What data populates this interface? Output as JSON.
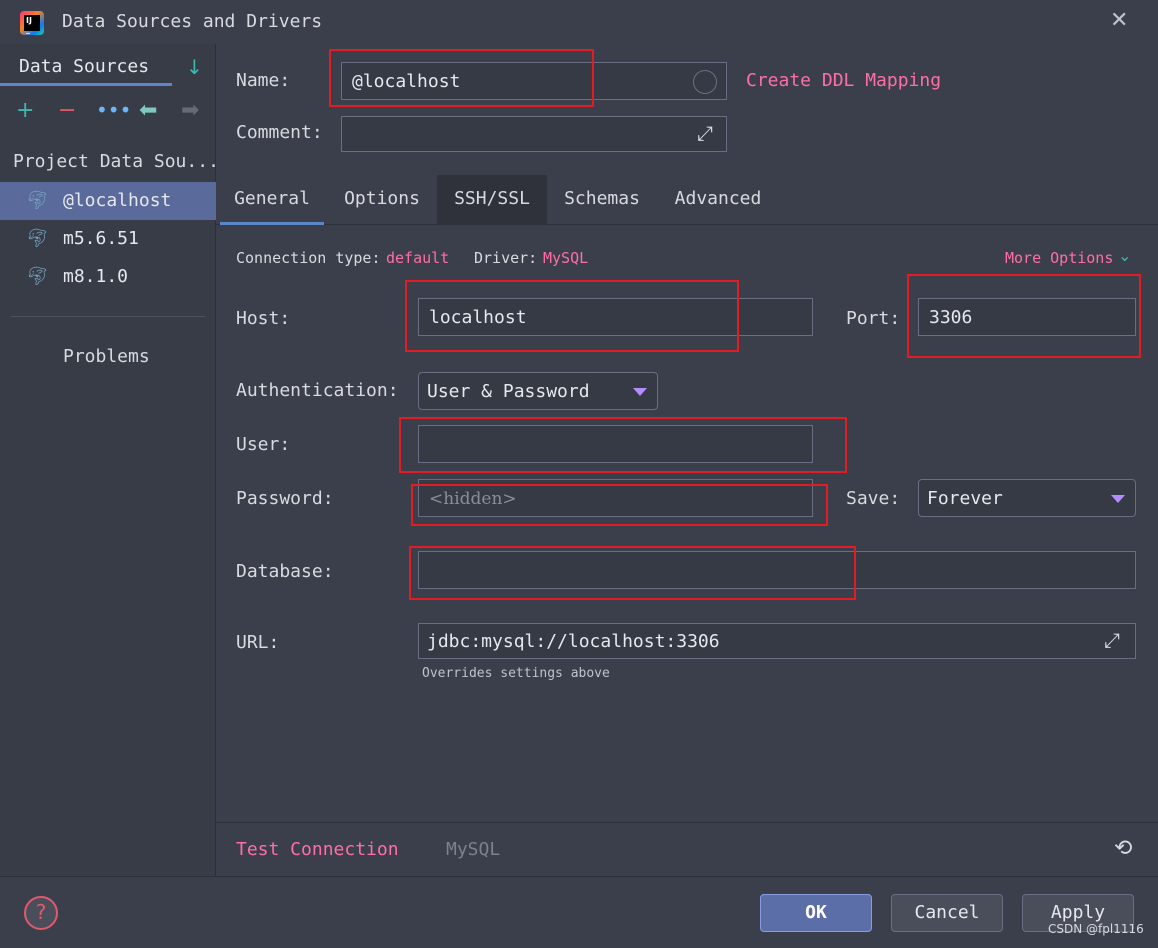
{
  "window": {
    "title": "Data Sources and Drivers",
    "close": "✕"
  },
  "sidebar": {
    "tab_label": "Data Sources",
    "section_title": "Project Data Sou...",
    "items": [
      {
        "label": "@localhost",
        "selected": true
      },
      {
        "label": "m5.6.51",
        "selected": false
      },
      {
        "label": "m8.1.0",
        "selected": false
      }
    ],
    "problems_label": "Problems"
  },
  "form": {
    "name_label": "Name:",
    "name_value": "@localhost",
    "create_ddl_link": "Create DDL Mapping",
    "comment_label": "Comment:",
    "comment_value": ""
  },
  "tabs": [
    {
      "label": "General",
      "active": true
    },
    {
      "label": "Options",
      "active": false
    },
    {
      "label": "SSH/SSL",
      "active": false
    },
    {
      "label": "Schemas",
      "active": false
    },
    {
      "label": "Advanced",
      "active": false
    }
  ],
  "general": {
    "connection_type_label": "Connection type:",
    "connection_type_value": "default",
    "driver_label": "Driver:",
    "driver_value": "MySQL",
    "more_options": "More Options",
    "host_label": "Host:",
    "host_value": "localhost",
    "port_label": "Port:",
    "port_value": "3306",
    "auth_label": "Authentication:",
    "auth_value": "User & Password",
    "user_label": "User:",
    "user_value": "",
    "password_label": "Password:",
    "password_placeholder": "<hidden>",
    "save_label": "Save:",
    "save_value": "Forever",
    "database_label": "Database:",
    "database_value": "",
    "url_label": "URL:",
    "url_value": "jdbc:mysql://localhost:3306",
    "url_hint": "Overrides settings above"
  },
  "form_footer": {
    "test_connection": "Test Connection",
    "driver_hint": "MySQL"
  },
  "footer": {
    "ok": "OK",
    "cancel": "Cancel",
    "apply": "Apply",
    "help": "?",
    "watermark": "CSDN @fpl1116"
  },
  "colors": {
    "accent_link": "#ff6ea6",
    "selection": "#5a6a9a",
    "annotation_red": "#e31b23"
  }
}
